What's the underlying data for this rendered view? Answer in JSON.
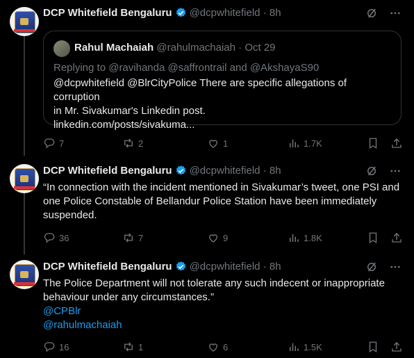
{
  "tweets": [
    {
      "name": "DCP Whitefield Bengaluru",
      "handle": "@dcpwhitefield",
      "time": "· 8h",
      "quote": {
        "name": "Rahul Machaiah",
        "handle": "@rahulmachaiah",
        "time": "· Oct 29",
        "replying": "Replying to @ravihanda @saffrontrail and @AkshayaS90",
        "line1": "@dcpwhitefield @BlrCityPolice There are specific allegations of corruption",
        "line2": "in Mr. Sivakumar's  Linkedin post.",
        "line3": "linkedin.com/posts/sivakuma..."
      },
      "replies": "7",
      "reposts": "2",
      "likes": "1",
      "views": "1.7K"
    },
    {
      "name": "DCP Whitefield Bengaluru",
      "handle": "@dcpwhitefield",
      "time": "· 8h",
      "line1": "“In connection with the incident mentioned in Sivakumar’s tweet, one PSI and",
      "line2": "one Police Constable of Bellandur Police Station have been immediately",
      "line3": "suspended.",
      "replies": "36",
      "reposts": "7",
      "likes": "9",
      "views": "1.8K"
    },
    {
      "name": "DCP Whitefield Bengaluru",
      "handle": "@dcpwhitefield",
      "time": "· 8h",
      "line1": "The Police Department will not tolerate any such indecent or inappropriate",
      "line2": "behaviour under any circumstances.”",
      "mention1": "@CPBlr",
      "mention2": "@rahulmachaiah",
      "replies": "16",
      "reposts": "1",
      "likes": "6",
      "views": "1.5K"
    }
  ],
  "colors": {
    "accent": "#1d9bf0",
    "muted": "#71767b",
    "text": "#e7e9ea",
    "border": "#2f3336"
  },
  "icons": [
    "verified-badge-icon",
    "grok-icon",
    "more-icon",
    "reply-icon",
    "repost-icon",
    "like-icon",
    "views-icon",
    "bookmark-icon",
    "share-icon"
  ]
}
